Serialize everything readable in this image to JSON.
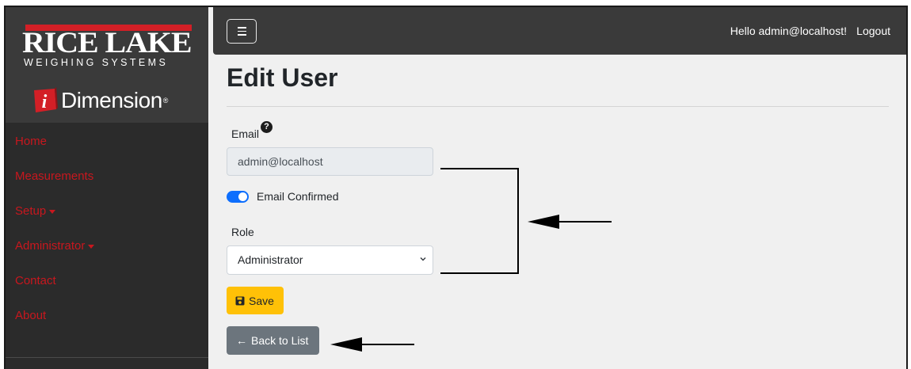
{
  "brand": {
    "company": "RICE LAKE",
    "tagline": "WEIGHING SYSTEMS",
    "product": "Dimension",
    "product_mark": "i",
    "registered": "®",
    "colors": {
      "accent_red": "#c8171e",
      "sidebar_bg": "#2b2b2b",
      "topbar_bg": "#3a3a3a"
    }
  },
  "sidebar": {
    "items": [
      {
        "label": "Home",
        "has_caret": false
      },
      {
        "label": "Measurements",
        "has_caret": false
      },
      {
        "label": "Setup",
        "has_caret": true
      },
      {
        "label": "Administrator",
        "has_caret": true
      },
      {
        "label": "Contact",
        "has_caret": false
      },
      {
        "label": "About",
        "has_caret": false
      }
    ]
  },
  "topbar": {
    "menu_icon": "hamburger-icon",
    "greeting": "Hello admin@localhost!",
    "logout_label": "Logout"
  },
  "page": {
    "title": "Edit User"
  },
  "form": {
    "email_label": "Email",
    "help_icon": "question-circle-icon",
    "help_glyph": "?",
    "email_value": "admin@localhost",
    "email_confirmed_label": "Email Confirmed",
    "email_confirmed_on": true,
    "role_label": "Role",
    "role_value": "Administrator",
    "save_label": "Save",
    "save_icon": "floppy-disk-icon",
    "save_color": "#ffc107",
    "back_label": "Back to List",
    "back_arrow": "←",
    "back_color": "#6c757d"
  }
}
